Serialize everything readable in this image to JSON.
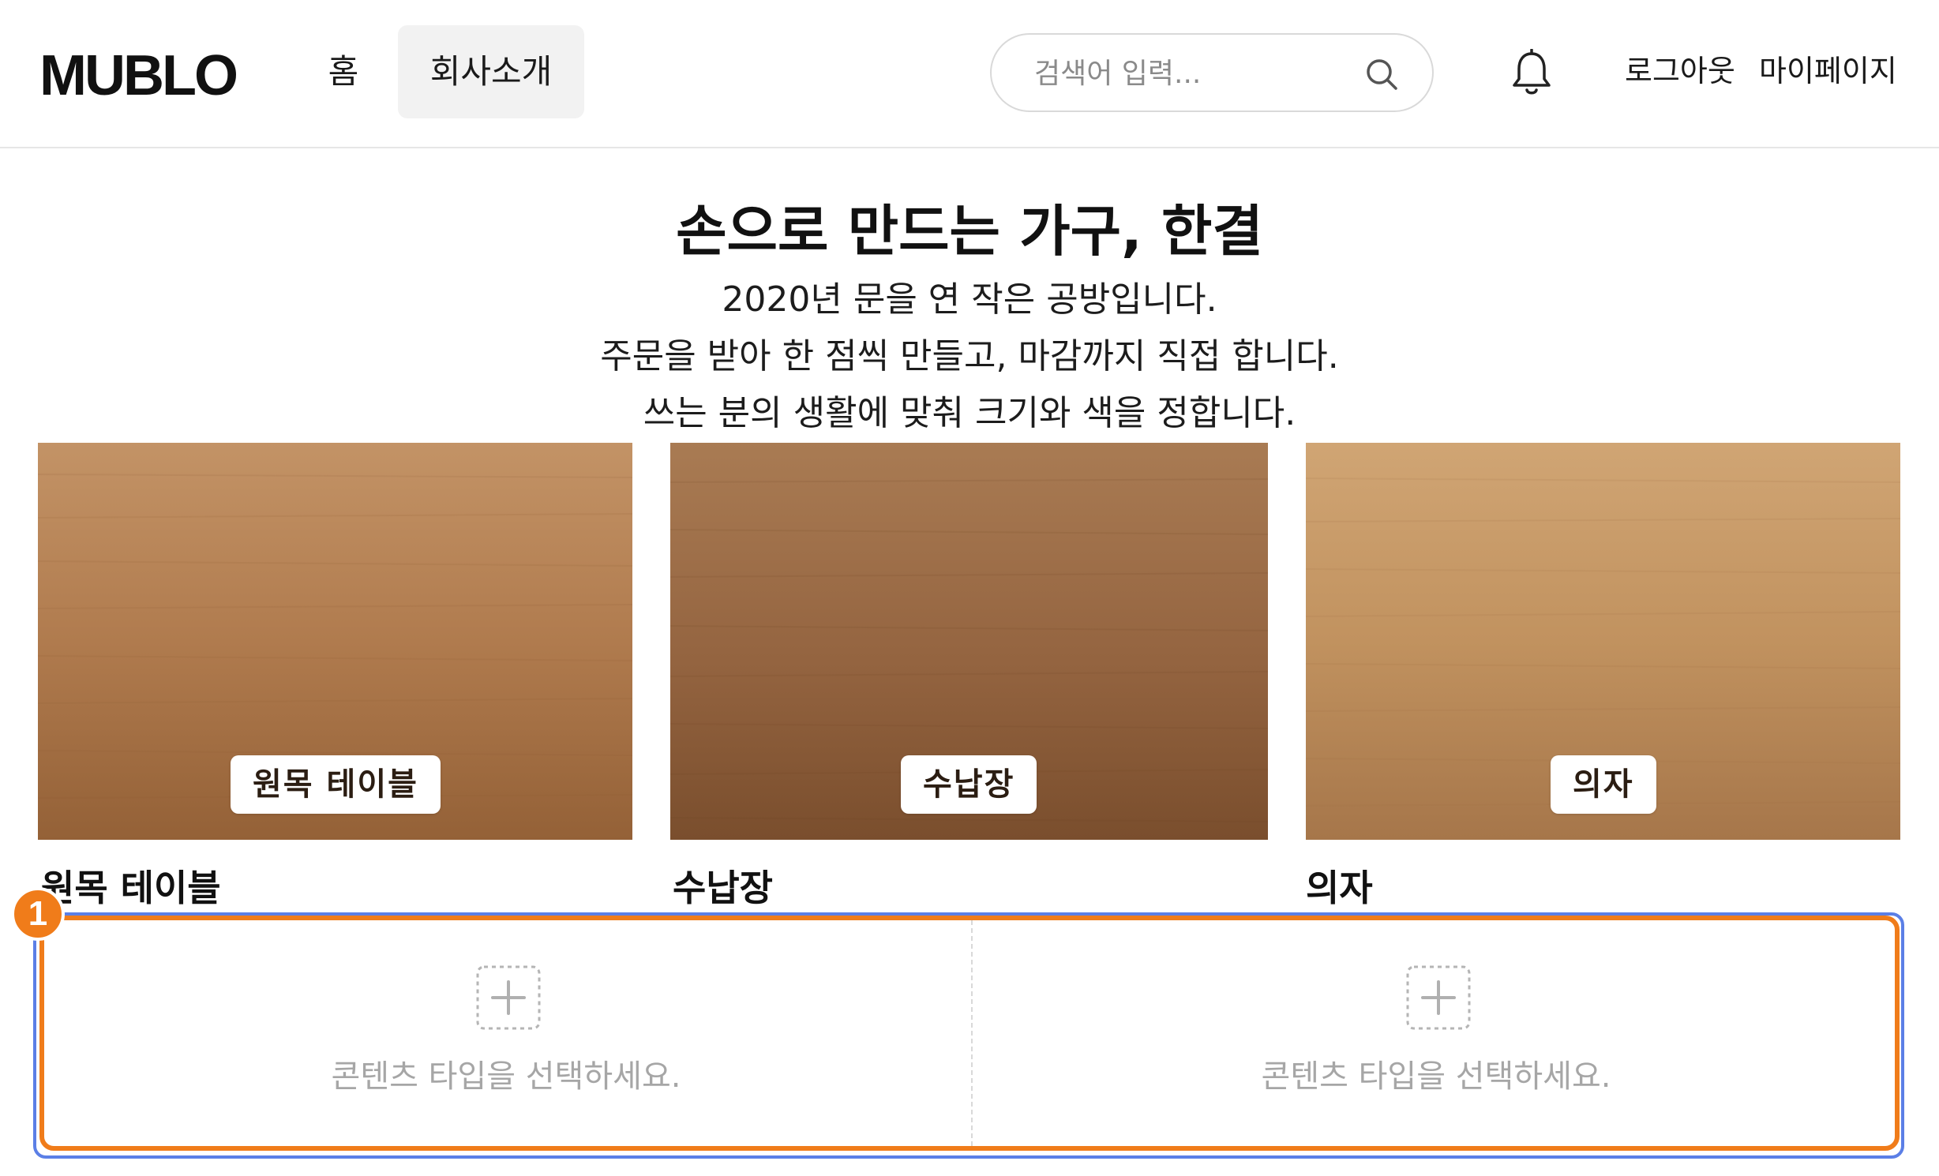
{
  "header": {
    "logo": "MUBLO",
    "nav": [
      {
        "label": "홈",
        "active": false
      },
      {
        "label": "회사소개",
        "active": true
      }
    ],
    "search": {
      "placeholder": "검색어 입력...",
      "value": "",
      "icon": "search-icon"
    },
    "bell_icon": "bell-icon",
    "logout_label": "로그아웃",
    "mypage_label": "마이페이지"
  },
  "hero": {
    "title": "손으로 만드는 가구, 한결",
    "lines": [
      "2020년 문을 연 작은 공방입니다.",
      "주문을 받아 한 점씩 만들고, 마감까지 직접 합니다.",
      "쓰는 분의 생활에 맞춰 크기와 색을 정합니다."
    ]
  },
  "products": [
    {
      "image_label": "원목 테이블",
      "title": "원목 테이블",
      "wood_tone": "#b07b4e"
    },
    {
      "image_label": "수납장",
      "title": "수납장",
      "wood_tone": "#9a6a42"
    },
    {
      "image_label": "의자",
      "title": "의자",
      "wood_tone": "#c1925f"
    }
  ],
  "content_slots": {
    "step_number": "1",
    "slots": [
      {
        "text": "콘텐츠 타입을 선택하세요.",
        "icon": "add-icon"
      },
      {
        "text": "콘텐츠 타입을 선택하세요.",
        "icon": "add-icon"
      }
    ]
  },
  "colors": {
    "highlight_orange": "#f07c1a",
    "highlight_blue": "#5b7fe6",
    "nav_active_bg": "#f2f2f2"
  }
}
